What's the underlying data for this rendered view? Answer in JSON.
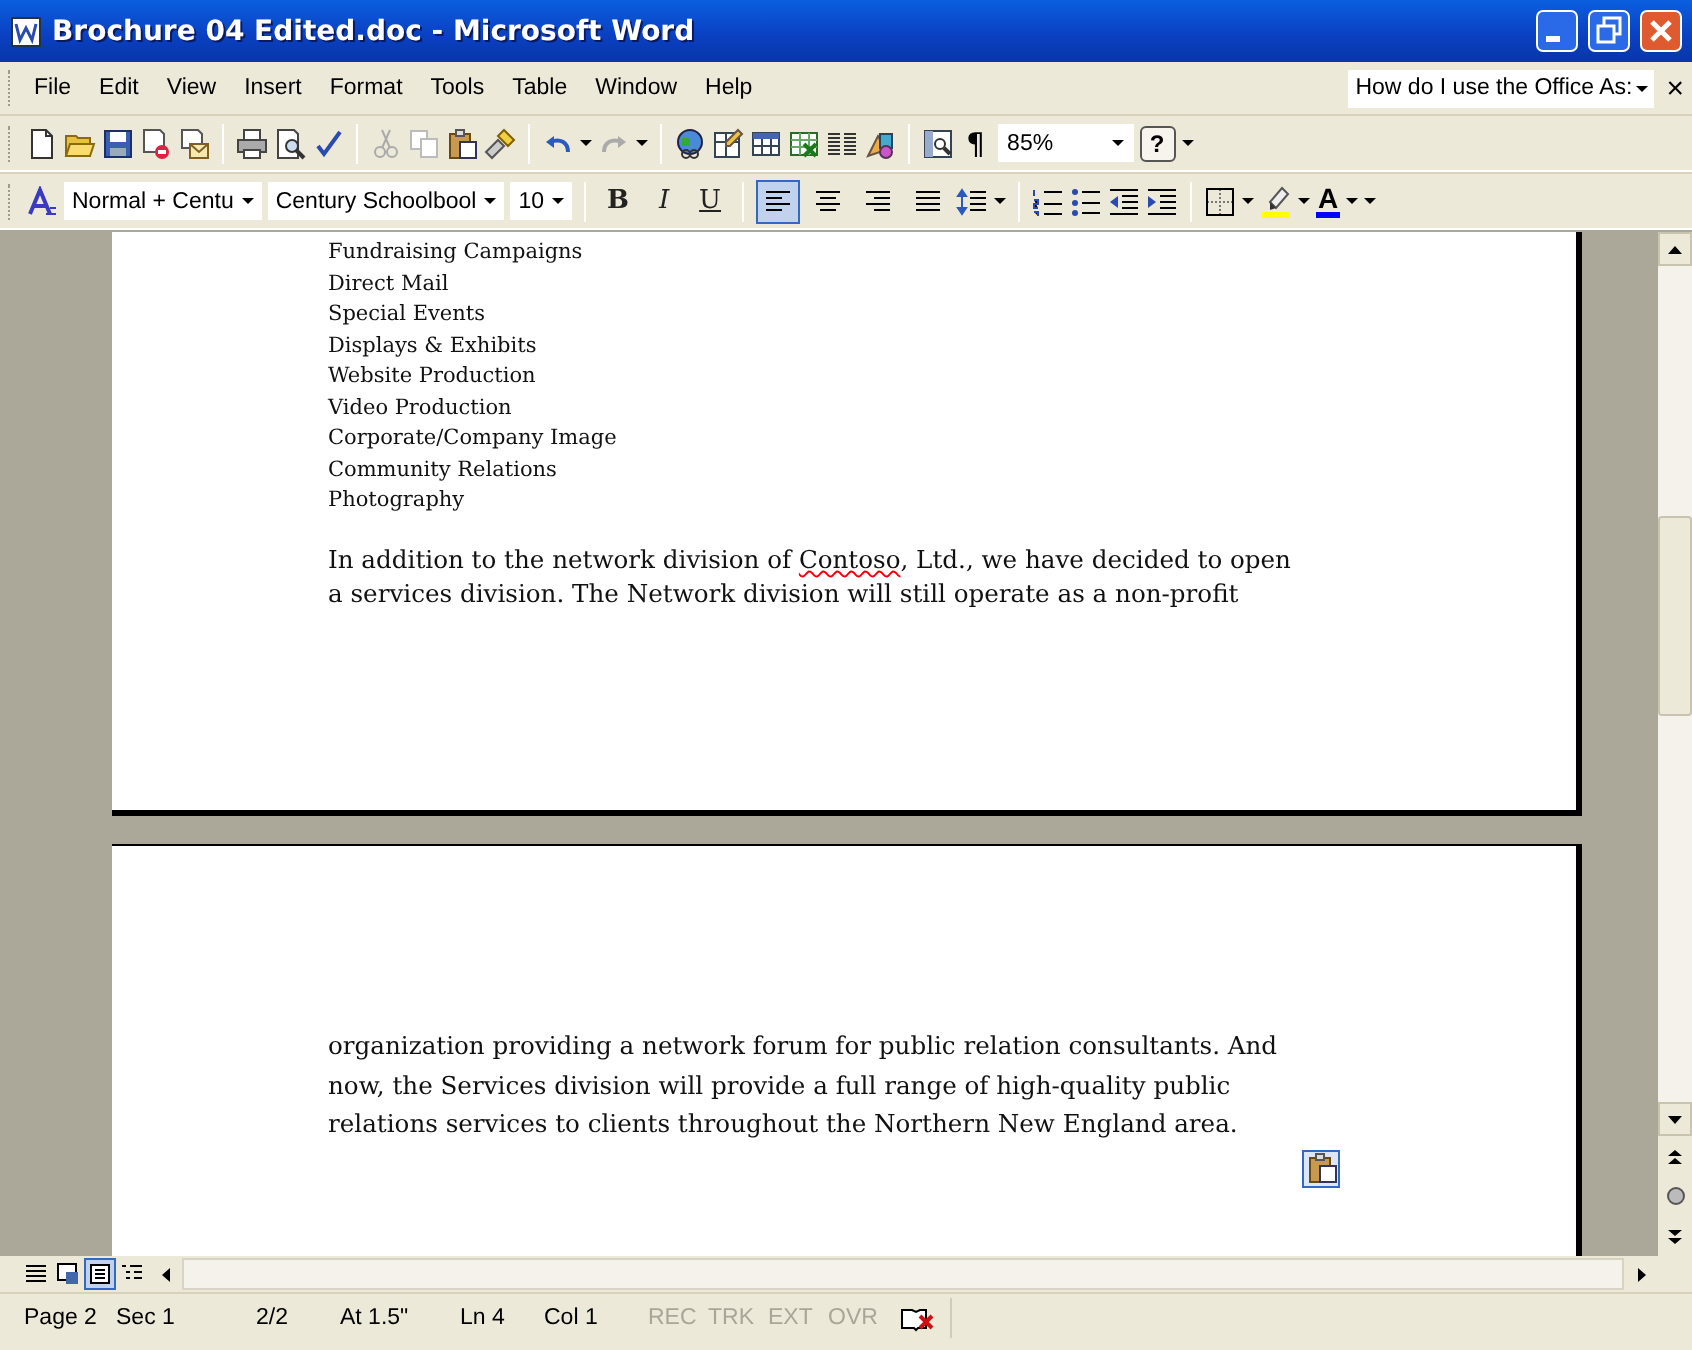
{
  "window": {
    "title": "Brochure 04 Edited.doc - Microsoft Word"
  },
  "menu": {
    "items": [
      "File",
      "Edit",
      "View",
      "Insert",
      "Format",
      "Tools",
      "Table",
      "Window",
      "Help"
    ],
    "help_box": "How do I use the Office As:",
    "close_glyph": "×"
  },
  "standard_toolbar": {
    "pilcrow": "¶",
    "zoom": "85%",
    "help_glyph": "?"
  },
  "formatting_toolbar": {
    "style": "Normal + Centu",
    "font": "Century Schoolbool",
    "size": "10",
    "bold": "B",
    "italic": "I",
    "underline": "U",
    "alignments": [
      {
        "selected": true
      },
      {
        "selected": false
      },
      {
        "selected": false
      },
      {
        "selected": false
      }
    ],
    "font_color_glyph": "A"
  },
  "document": {
    "list": [
      "Fundraising Campaigns",
      "Direct Mail",
      "Special Events",
      "Displays & Exhibits",
      "Website Production",
      "Video Production",
      "Corporate/Company Image",
      "Community Relations",
      "Photography"
    ],
    "paragraph_1": [
      [
        {
          "text": "In addition to the network division of "
        },
        {
          "text": "Contoso",
          "misspelled": true
        },
        {
          "text": ", Ltd., we have decided to open"
        }
      ],
      [
        {
          "text": "a services division. The Network division will still operate as a non-profit"
        }
      ]
    ],
    "paragraph_2": [
      [
        {
          "text": "organization providing a network forum for public relation consultants. And"
        }
      ],
      [
        {
          "text": "now, the Services division will provide a full range of high-quality public"
        }
      ],
      [
        {
          "text": "relations services to clients throughout the Northern New England area."
        }
      ]
    ]
  },
  "view_buttons": [
    {
      "selected": false
    },
    {
      "selected": false
    },
    {
      "selected": true
    },
    {
      "selected": false
    }
  ],
  "status_bar": {
    "items": [
      {
        "text": "Page 2",
        "disabled": false
      },
      {
        "text": "Sec 1",
        "disabled": false
      },
      {
        "text": "2/2",
        "disabled": false
      },
      {
        "text": "At 1.5\"",
        "disabled": false
      },
      {
        "text": "Ln 4",
        "disabled": false
      },
      {
        "text": "Col 1",
        "disabled": false
      },
      {
        "text": "REC",
        "disabled": true
      },
      {
        "text": "TRK",
        "disabled": true
      },
      {
        "text": "EXT",
        "disabled": true
      },
      {
        "text": "OVR",
        "disabled": true
      }
    ]
  }
}
